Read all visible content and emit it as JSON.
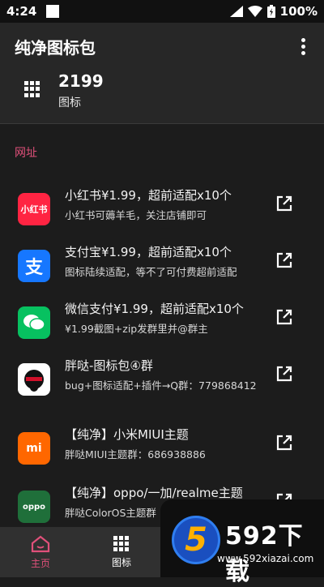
{
  "status_bar": {
    "time": "4:24",
    "battery": "100%"
  },
  "app_bar": {
    "title": "纯净图标包",
    "more_icon": "more-vert-icon"
  },
  "summary": {
    "count": "2199",
    "label": "图标"
  },
  "section_title": "网址",
  "colors": {
    "accent": "#e0507a",
    "background": "#1c1c1c",
    "surface": "#272727"
  },
  "items": [
    {
      "icon_text": "小红书",
      "icon_color": "#ff2442",
      "title": "小红书¥1.99，超前适配x10个",
      "subtitle": "小红书可薅羊毛，关注店铺即可"
    },
    {
      "icon_text": "支",
      "icon_color": "#1677ff",
      "title": "支付宝¥1.99，超前适配x10个",
      "subtitle": "图标陆续适配，等不了可付费超前适配"
    },
    {
      "icon_text": "微信",
      "icon_color": "#07c160",
      "title": "微信支付¥1.99，超前适配x10个",
      "subtitle": "¥1.99截图+zip发群里并@群主"
    },
    {
      "icon_text": "",
      "icon_color": "#ffffff",
      "title": "胖哒-图标包④群",
      "subtitle": "bug+图标适配+插件→Q群：779868412"
    },
    {
      "icon_text": "mi",
      "icon_color": "#ff6700",
      "title": "【纯净】小米MIUI主题",
      "subtitle": "胖哒MIUI主题群：686938886"
    },
    {
      "icon_text": "oppo",
      "icon_color": "#1f6f3a",
      "title": "【纯净】oppo/一加/realme主题",
      "subtitle": "胖哒ColorOS主题群"
    }
  ],
  "bottom_nav": [
    {
      "label": "主页",
      "icon": "home-icon",
      "active": true
    },
    {
      "label": "图标",
      "icon": "grid-icon",
      "active": false
    }
  ],
  "watermark": {
    "logo_text": "5",
    "title": "592下载",
    "url": "www.592xiazai.com"
  }
}
